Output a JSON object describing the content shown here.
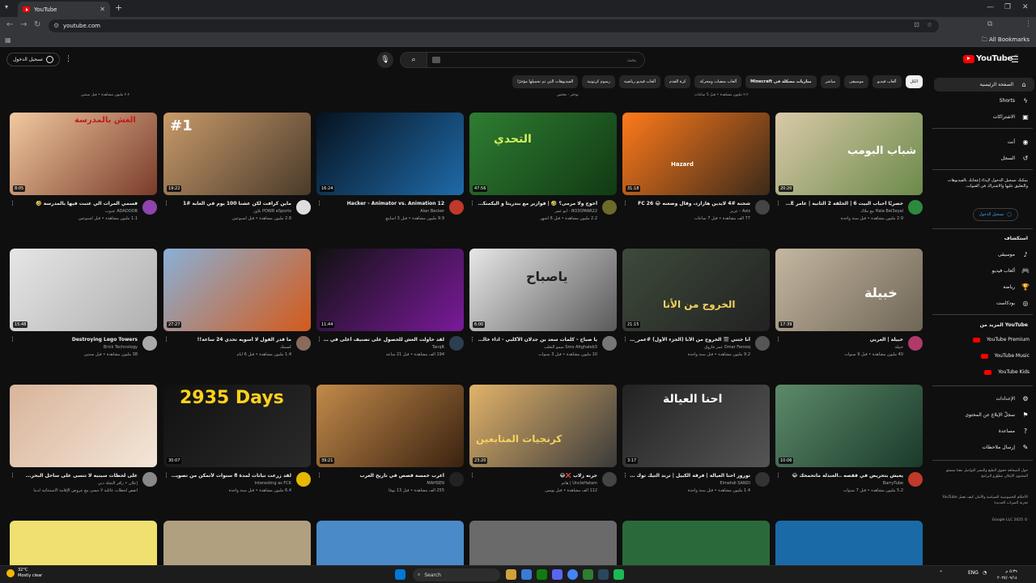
{
  "browser": {
    "tab_title": "YouTube",
    "tab_close": "✕",
    "new_tab": "+",
    "url": "youtube.com",
    "profile_initial": "AI",
    "all_bookmarks": "All Bookmarks"
  },
  "header": {
    "signin_label": "تسجيل الدخول",
    "search_placeholder": "بحث",
    "logo_text": "YouTube",
    "logo_country": "AE"
  },
  "chips": [
    {
      "label": "الكل",
      "active": true
    },
    {
      "label": "ألعاب فيديو"
    },
    {
      "label": "موسيقى"
    },
    {
      "label": "مباشر"
    },
    {
      "label": "مباريات مسكلة في Minecraft",
      "bold": true
    },
    {
      "label": "ألعاب منصات ومحركة"
    },
    {
      "label": "كرة القدم"
    },
    {
      "label": "ألعاب فيديو رياضية"
    },
    {
      "label": "رسوم كرتونية"
    },
    {
      "label": "الفيديوهات التي تم تحميلها مؤخرًا"
    }
  ],
  "previous_row_stats": [
    "٢.٢ مليون مشاهدة • قبل سنتين",
    "٢.٢ مليون مشاهدة • قبل 5 ساعات",
    "بوختر - مختص"
  ],
  "sidebar": {
    "home": "الصفحة الرئيسية",
    "shorts": "Shorts",
    "subscriptions": "الاشتراكات",
    "you": "أنت",
    "history": "السجل",
    "signin_prompt": "يمكنك تسجيل الدخول لإبداء إعجابك بالفيديوهات والتعليق عليها والاشتراك في القنوات.",
    "signin_button": "تسجيل الدخول",
    "explore_title": "استكشاف",
    "explore": [
      "موسيقى",
      "ألعاب فيديو",
      "رياضة",
      "بودكاست"
    ],
    "more_title": "المزيد من YouTube",
    "more": [
      "YouTube Premium",
      "YouTube Music",
      "YouTube Kids"
    ],
    "settings": [
      "الإعدادات",
      "سجلّ الإبلاغ عن المحتوى",
      "مساعدة",
      "إرسال ملاحظات"
    ],
    "footer1": "حول الصحافة حقوق الطبع والنشر التواصل معنا منشئو المحتوى الإعلان مطوّرو البرامج",
    "footer2": "الأحكام الخصوصية السياسة والأمان كيف تعمل YouTube تجربة الميزات الجديدة",
    "copyright": "© 2025 Google LLC"
  },
  "videos": [
    {
      "title": "حصريًا أحباب البيت 6 | الحلقة 2 الثانية | عامر WELCOME",
      "channel": "Hala Bel3eyal مع ملاك",
      "stats": "2.9 مليون مشاهدة • قبل سنة واحدة",
      "duration": "20:20",
      "thumb_text": "شباب البومب"
    },
    {
      "title": "شحنة #4 لايدين هازارد، وقال وضعنه 😂 FC 26",
      "channel": "Aziz - عزيز",
      "stats": "77 ألف مشاهدة • قبل 7 ساعات",
      "duration": "31:18",
      "thumb_text": "Hazard"
    },
    {
      "title": "أحوج ولا مرمى؟ 🤣 | فوازير مع بندريتا و البكمنكي و براء",
      "channel": "BO3OMAR22 - ابو عمر",
      "stats": "2.2 مليون مشاهدة • قبل 6 أشهر",
      "duration": "47:56",
      "thumb_text": "التحدي"
    },
    {
      "title": "Hacker - Animator vs. Animation 12",
      "channel": "Alan Becker",
      "stats": "9.9 مليون مشاهدة • قبل 3 أسابيع",
      "duration": "16:24",
      "thumb_text": ""
    },
    {
      "title": "ماين كرافت لكن عشنا 100 يوم في الغابة #1",
      "channel": "POWR eSports بلاور",
      "stats": "2.8 مليون مشاهدة • قبل أسبوعين",
      "duration": "19:22",
      "thumb_text": "#1"
    },
    {
      "title": "قسمي المرات الي عتبت فيها بالمدرسة 🤣",
      "channel": "ADADOOB عدوب",
      "stats": "1.1 مليون مشاهدة • قبل أسبوعين",
      "duration": "8:05",
      "thumb_text": "الغش بالمدرسة"
    },
    {
      "title": "خبيلة | الغربي",
      "channel": "خبيلة",
      "stats": "40 مليون مشاهدة • قبل 9 سنوات",
      "duration": "17:39",
      "thumb_text": "خبيلة"
    },
    {
      "title": "أنا جتني 🎬 الخروج من الأنا (الجزء الأول) #عمر_جريب",
      "channel": "Omar Farooq عمر فاروق",
      "stats": "9.2 مليون مشاهدة • قبل سنة واحدة",
      "duration": "21:15",
      "thumb_text": "الخروج من الأنا"
    },
    {
      "title": "يا صباح - كلمات سعد بن جدلان الأكلبي - اداء خالد آل بريك حصريا 2022",
      "channel": "Smo Altghaleb3 سمو التغلب",
      "stats": "10 مليون مشاهدة • قبل 3 سنوات",
      "duration": "6:00",
      "thumb_text": "ياصباح"
    },
    {
      "title": "لقد حاولت الغش للحصول على تصنيف أعلى في Roblox Rivals",
      "channel": "TanqR",
      "stats": "194 ألف مشاهدة • قبل 21 ساعة",
      "duration": "11:44",
      "thumb_text": ""
    },
    {
      "title": "ما قدر الفول لا أسويه تحدي 24 ساعة!!",
      "channel": "كسمك",
      "stats": "1.4 مليون مشاهدة • قبل 6 أيام",
      "duration": "27:27",
      "thumb_text": ""
    },
    {
      "title": "Destroying Lego Towers",
      "channel": "Brick Technology",
      "stats": "38 مليون مشاهدة • قبل سنتين",
      "duration": "15:48",
      "thumb_text": ""
    },
    {
      "title": "يعيش بتحريض في قفصه ..العندلة ماتحمحك 😂",
      "channel": "BarryTube",
      "stats": "5.2 مليون مشاهدة • قبل 7 سنوات",
      "duration": "10:06",
      "thumb_text": ""
    },
    {
      "title": "نوروز احنا العيالة | فرقة الكبيل | ترند التيك توك 2024",
      "channel": "Elmehdi SANDI",
      "stats": "1.4 مليون مشاهدة • قبل سنة واحدة",
      "duration": "3:17",
      "thumb_text": "احنا العيالة"
    },
    {
      "title": "جرنه زلاب ❌😂",
      "channel": "UncleHatam | هاتم",
      "stats": "112 ألف مشاهدة • قبل يومين",
      "duration": "23:20",
      "thumb_text": "كرنجيات المتابعين"
    },
    {
      "title": "أغرب خمسة قصص في تاريخ العرب",
      "channel": "MAHSEN",
      "stats": "255 ألف مشاهدة • قبل 13 يومًا",
      "duration": "39:21",
      "thumb_text": ""
    },
    {
      "title": "لقد زرعت نباتات لمدة 8 سنوات لأتمكن من تصوير هذه اللقطات المتتالية [8K]",
      "channel": "Interesting as FCK",
      "stats": "6.4 مليون مشاهدة • قبل سنة واحدة",
      "duration": "30:07",
      "thumb_text": "2935 Days"
    },
    {
      "title": "على لحظات سينيه لا تنسى على ساحل البحر...",
      "channel": "إعلان • زافر التجلة دبي",
      "stats": "انقص لحظات عائلية لا تنسى مع عروض الإقامة الاستثنائية لدينا",
      "duration": "",
      "thumb_text": ""
    }
  ],
  "taskbar": {
    "temp": "32°C",
    "weather": "Mostly clear",
    "search": "Search",
    "lang": "ENG",
    "time": "٥:٣٩ م",
    "date": "٢٠٢٥/٠٩/١٤"
  },
  "colors": {
    "accent_red": "#ff0000",
    "link_blue": "#3ea6ff",
    "background": "#0f0f0f"
  }
}
